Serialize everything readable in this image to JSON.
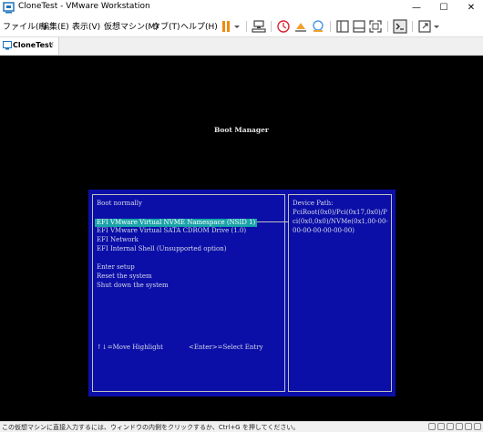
{
  "window": {
    "title": "CloneTest - VMware Workstation",
    "minimize": "—",
    "maximize": "☐",
    "close": "✕"
  },
  "menu": {
    "items": [
      "ファイル(F)",
      "編集(E)",
      "表示(V)",
      "仮想マシン(M)",
      "タブ(T)",
      "ヘルプ(H)"
    ]
  },
  "toolbar": {
    "icons": [
      "pause-icon",
      "dropdown-icon",
      "network-icon",
      "snapshot-icon",
      "revert-snapshot-icon",
      "manage-snapshots-icon",
      "library-icon",
      "thumbnail-icon",
      "fullscreen-icon",
      "console-view-icon",
      "stretch-icon"
    ]
  },
  "tabs": [
    {
      "label": "CloneTest",
      "close": "✕"
    }
  ],
  "boot_manager": {
    "title": "Boot Manager",
    "items": [
      "Boot normally",
      "EFI VMware Virtual NVME Namespace (NSID 1)",
      "EFI VMware Virtual SATA CDROM Drive (1.0)",
      "EFI Network",
      "EFI Internal Shell (Unsupported option)",
      "Enter setup",
      "Reset the system",
      "Shut down the system"
    ],
    "selected_index": 1,
    "device_path_label": "Device Path:",
    "device_path": "PciRoot(0x0)/Pci(0x17,0x0)/Pci(0x0,0x0)/NVMe(0x1,00-00-00-00-00-00-00-00)",
    "footer_nav": "↑↓=Move Highlight",
    "footer_select": "<Enter>=Select Entry"
  },
  "status": {
    "text": "この仮想マシンに直接入力するには、ウィンドウの内側をクリックするか、Ctrl+G を押してください。"
  },
  "colors": {
    "bios_blue": "#0b0fa8",
    "highlight": "#1aa3a8",
    "pause_orange": "#f08a10"
  }
}
